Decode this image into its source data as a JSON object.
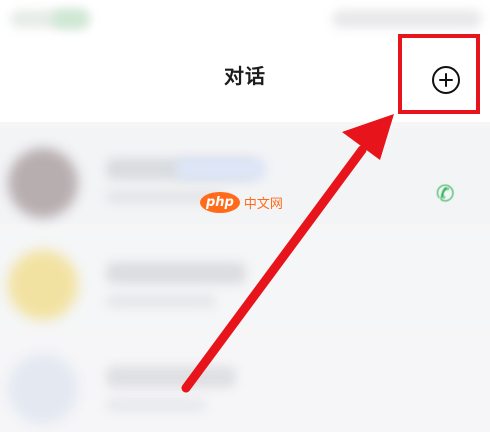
{
  "header": {
    "title": "对话",
    "add_button": {
      "icon": "plus-circle-icon"
    }
  },
  "annotation": {
    "color": "#e8141b"
  },
  "watermark": {
    "logo_text": "php",
    "site_text": "中文网"
  },
  "conversations": [
    {
      "has_call_icon": true,
      "call_icon": "phone-icon"
    },
    {
      "has_call_icon": false
    },
    {
      "has_call_icon": false
    }
  ],
  "colors": {
    "accent": "#e8141b",
    "call_green": "#22b14c",
    "watermark_orange": "#ff6b1a"
  }
}
